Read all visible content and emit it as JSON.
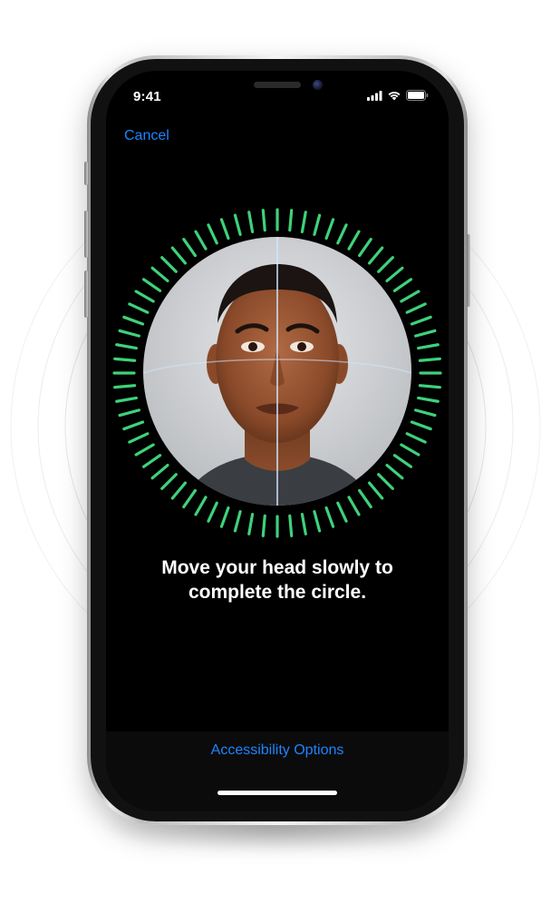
{
  "status_bar": {
    "time": "9:41"
  },
  "nav": {
    "cancel_label": "Cancel"
  },
  "scan": {
    "progress": 1.0,
    "tick_color": "#3fd17a"
  },
  "instruction": {
    "line1": "Move your head slowly to",
    "line2": "complete the circle."
  },
  "footer": {
    "accessibility_label": "Accessibility Options"
  },
  "colors": {
    "accent": "#1f84ff",
    "tick": "#3fd17a",
    "screen_bg": "#000000"
  },
  "icons": {
    "signal": "cellular-signal-icon",
    "wifi": "wifi-icon",
    "battery": "battery-icon"
  }
}
